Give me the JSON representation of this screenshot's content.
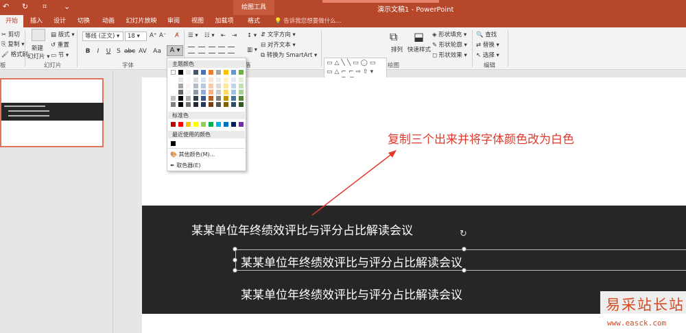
{
  "titlebar": {
    "quick_access": [
      "↶",
      "↻",
      "⌗",
      "⌄"
    ],
    "tools_tab_group": "绘图工具",
    "document_title": "演示文稿1 - PowerPoint"
  },
  "tabs": [
    {
      "label": "开始",
      "active": true
    },
    {
      "label": "插入"
    },
    {
      "label": "设计"
    },
    {
      "label": "切换"
    },
    {
      "label": "动画"
    },
    {
      "label": "幻灯片放映"
    },
    {
      "label": "审阅"
    },
    {
      "label": "视图"
    },
    {
      "label": "加载项"
    },
    {
      "label": "格式"
    }
  ],
  "tell_me": "告诉我您想要做什么...",
  "ribbon": {
    "clipboard": {
      "cut": "剪切",
      "copy": "复制",
      "format_painter": "格式刷",
      "group": "板"
    },
    "slides": {
      "new_slide_1": "新建",
      "new_slide_2": "幻灯片 ▾",
      "layout": "版式 ▾",
      "reset": "重置",
      "section": "节 ▾",
      "group": "幻灯片"
    },
    "font": {
      "font_name": "等线 (正文)",
      "font_size": "18",
      "group": "字体"
    },
    "paragraph": {
      "text_direction": "文字方向 ▾",
      "align_text": "对齐文本 ▾",
      "convert_smartart": "转换为 SmartArt ▾",
      "group": "落"
    },
    "drawing": {
      "arrange": "排列",
      "quick_styles": "快速样式",
      "shape_fill": "形状填充 ▾",
      "shape_outline": "形状轮廓 ▾",
      "shape_effects": "形状效果 ▾",
      "group": "绘图"
    },
    "editing": {
      "find": "查找",
      "replace": "替换 ▾",
      "select": "选择 ▾",
      "group": "编辑"
    }
  },
  "slide": {
    "annotation": "复制三个出来并将字体颜色改为白色",
    "lines": [
      "某某单位年终绩效评比与评分占比解读会议",
      "某某单位年终绩效评比与评分占比解读会议",
      "某某单位年终绩效评比与评分占比解读会议"
    ]
  },
  "color_menu": {
    "theme_colors": "主题颜色",
    "standard_colors": "标准色",
    "recent_colors": "最近使用的颜色",
    "more_colors": "其他颜色(M)...",
    "eyedropper": "取色器(E)",
    "theme_row": [
      "#ffffff",
      "#000000",
      "#e7e6e6",
      "#44546a",
      "#4472c4",
      "#ed7d31",
      "#a5a5a5",
      "#ffc000",
      "#5b9bd5",
      "#70ad47"
    ],
    "standard_row": [
      "#c00000",
      "#ff0000",
      "#ffc000",
      "#ffff00",
      "#92d050",
      "#00b050",
      "#00b0f0",
      "#0070c0",
      "#002060",
      "#7030a0"
    ],
    "recent_row": [
      "#000000"
    ]
  },
  "watermark": {
    "line1": "易采站长站",
    "line2": "www.easck.com"
  },
  "colors": {
    "accent": "#b7472a",
    "band": "#262626",
    "annotation_red": "#e2382c"
  }
}
